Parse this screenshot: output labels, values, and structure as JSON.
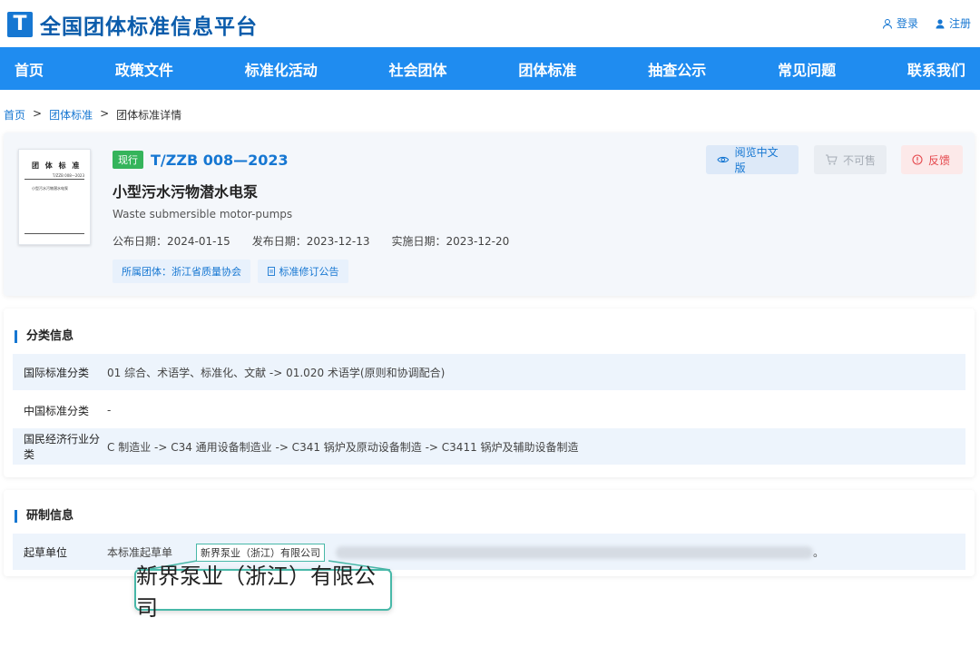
{
  "header": {
    "logo_letter": "T",
    "site_title": "全国团体标准信息平台",
    "login": "登录",
    "register": "注册"
  },
  "nav": [
    "首页",
    "政策文件",
    "标准化活动",
    "社会团体",
    "团体标准",
    "抽查公示",
    "常见问题",
    "联系我们"
  ],
  "breadcrumb": {
    "home": "首页",
    "sep1": ">",
    "section": "团体标准",
    "sep2": ">",
    "current": "团体标准详情"
  },
  "standard": {
    "status": "现行",
    "code": "T/ZZB 008—2023",
    "title": "小型污水污物潜水电泵",
    "title_en": "Waste submersible motor-pumps",
    "publish_date": "公布日期：2024-01-15",
    "release_date": "发布日期：2023-12-13",
    "effective_date": "实施日期：2023-12-20",
    "org_chip": "所属团体：浙江省质量协会",
    "amend_chip": "标准修订公告",
    "thumbnail": {
      "heading": "团 体 标 准",
      "code": "T/ZZB 008—2023",
      "name": "小型污水污物潜水电泵"
    }
  },
  "actions": {
    "read_cn": "阅览中文版",
    "not_for_sale": "不可售",
    "feedback": "反馈"
  },
  "classification": {
    "title": "分类信息",
    "rows": [
      {
        "label": "国际标准分类",
        "value": "01 综合、术语学、标准化、文献 -> 01.020 术语学(原则和协调配合)"
      },
      {
        "label": "中国标准分类",
        "value": "-"
      },
      {
        "label": "国民经济行业分类",
        "value": "C 制造业 -> C34 通用设备制造业 -> C341 锅炉及原动设备制造 -> C3411 锅炉及辅助设备制造"
      }
    ]
  },
  "development": {
    "title": "研制信息",
    "drafter_label": "起草单位",
    "drafter_prefix": "本标准起草单",
    "drafter_suffix": "。"
  },
  "callout": {
    "text": "新界泵业（浙江）有限公司"
  },
  "colors": {
    "primary": "#1f8cf0",
    "brand": "#0b5cab",
    "status_green": "#35b45b",
    "danger": "#e5484d",
    "callout_border": "#48b8a8"
  }
}
